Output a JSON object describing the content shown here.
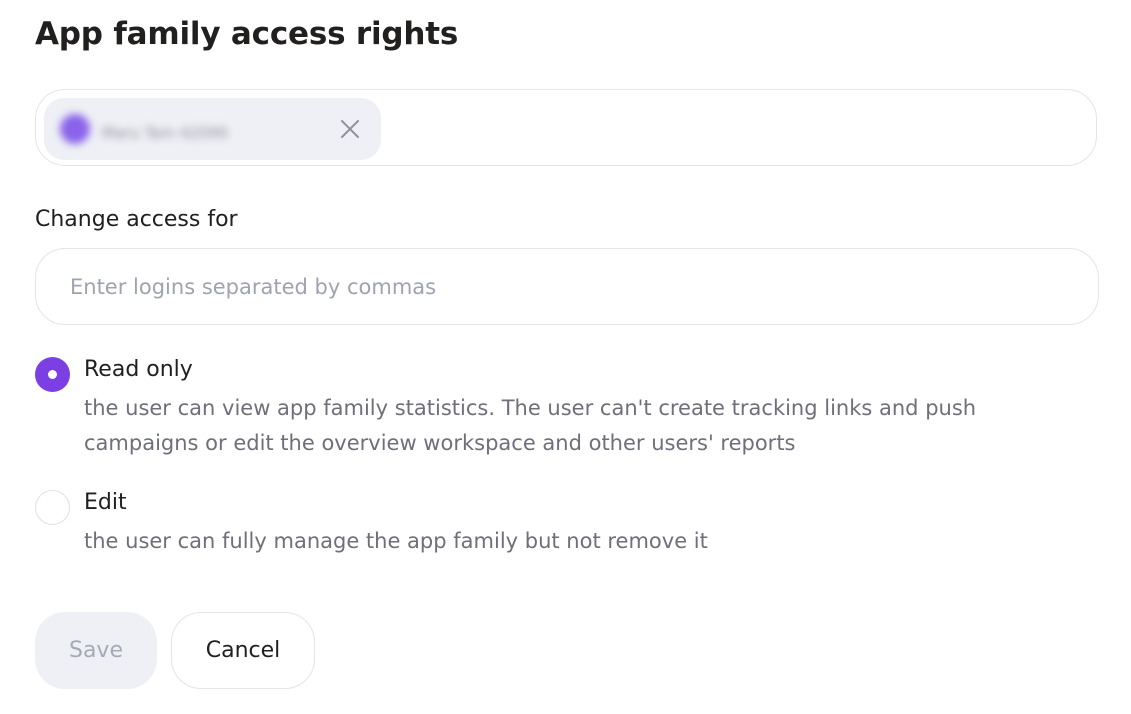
{
  "dialog": {
    "title": "App family access rights"
  },
  "selected_users": {
    "chips": [
      {
        "name": "Maru Tam 42099",
        "avatar_color": "#8a63ea",
        "remove_icon": "close-icon"
      }
    ]
  },
  "change_access": {
    "label": "Change access for",
    "input_value": "",
    "input_placeholder": "Enter logins separated by commas"
  },
  "access_options": [
    {
      "title": "Read only",
      "description": "the user can view app family statistics. The user can't create tracking links and push campaigns or edit the overview workspace and other users' reports",
      "checked": true
    },
    {
      "title": "Edit",
      "description": "the user can fully manage the app family but not remove it",
      "checked": false
    }
  ],
  "actions": {
    "save_label": "Save",
    "save_disabled": true,
    "cancel_label": "Cancel"
  },
  "colors": {
    "accent": "#7b3fe4",
    "text_primary": "#21201f",
    "text_secondary": "#6e6f7a",
    "placeholder": "#9fa3ae",
    "border": "#e3e5ea",
    "disabled_bg": "#eef0f5"
  }
}
